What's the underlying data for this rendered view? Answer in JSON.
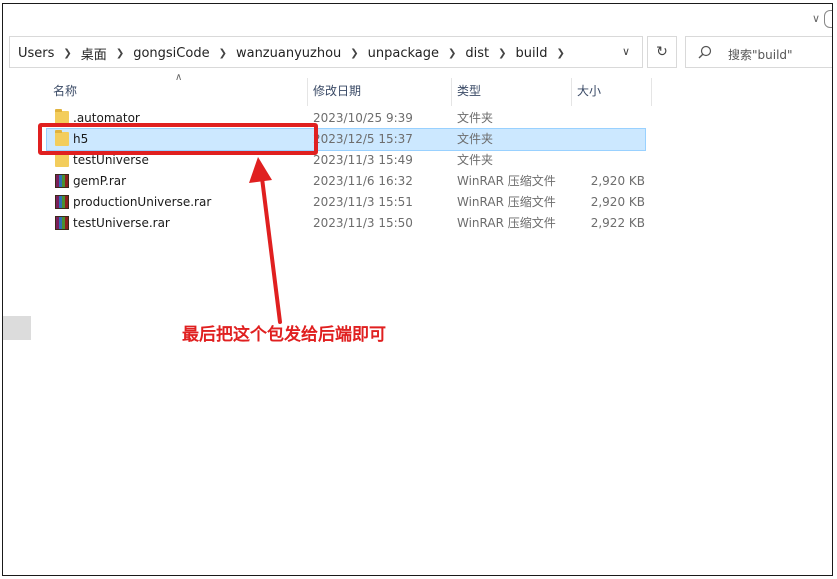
{
  "top": {
    "collapse_icon": "chevron-down-icon"
  },
  "breadcrumb": [
    "Users",
    "桌面",
    "gongsiCode",
    "wanzuanyuzhou",
    "unpackage",
    "dist",
    "build"
  ],
  "address": {
    "dropdown_icon": "chevron-down-icon",
    "refresh_icon": "refresh-icon"
  },
  "search": {
    "placeholder": "搜索\"build\""
  },
  "columns": {
    "name": "名称",
    "date": "修改日期",
    "type": "类型",
    "size": "大小"
  },
  "files": [
    {
      "name": ".automator",
      "date": "2023/10/25 9:39",
      "type": "文件夹",
      "size": "",
      "icon": "folder-icon"
    },
    {
      "name": "h5",
      "date": "2023/12/5 15:37",
      "type": "文件夹",
      "size": "",
      "icon": "folder-icon",
      "selected": true
    },
    {
      "name": "testUniverse",
      "date": "2023/11/3 15:49",
      "type": "文件夹",
      "size": "",
      "icon": "folder-icon"
    },
    {
      "name": "gemP.rar",
      "date": "2023/11/6 16:32",
      "type": "WinRAR 压缩文件",
      "size": "2,920 KB",
      "icon": "rar-icon"
    },
    {
      "name": "productionUniverse.rar",
      "date": "2023/11/3 15:51",
      "type": "WinRAR 压缩文件",
      "size": "2,920 KB",
      "icon": "rar-icon"
    },
    {
      "name": "testUniverse.rar",
      "date": "2023/11/3 15:50",
      "type": "WinRAR 压缩文件",
      "size": "2,922 KB",
      "icon": "rar-icon"
    }
  ],
  "annotation": {
    "text": "最后把这个包发给后端即可",
    "color": "#e02020"
  },
  "colors": {
    "selection": "#cce8ff",
    "annotation_red": "#e02020",
    "folder": "#f3cd5c"
  }
}
